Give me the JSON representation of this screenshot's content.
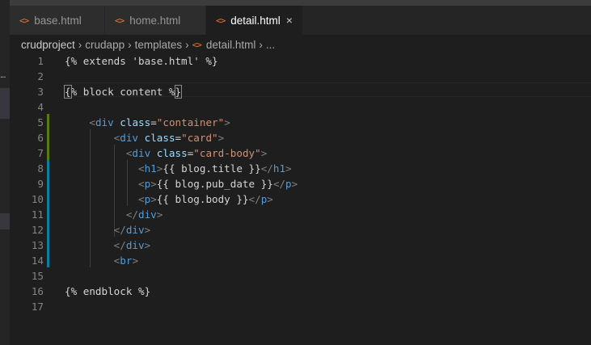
{
  "tabs": [
    {
      "label": "base.html",
      "icon": "html-file-icon",
      "glyph": "<>",
      "active": false
    },
    {
      "label": "home.html",
      "icon": "html-file-icon",
      "glyph": "<>",
      "active": false
    },
    {
      "label": "detail.html",
      "icon": "html-file-icon",
      "glyph": "<>",
      "active": true,
      "close": "×"
    }
  ],
  "breadcrumb": {
    "items": [
      "crudproject",
      "crudapp",
      "templates",
      "detail.html",
      "..."
    ],
    "separator": "›"
  },
  "editor": {
    "lines": [
      {
        "n": "1",
        "text": "{% extends 'base.html' %}"
      },
      {
        "n": "2",
        "text": ""
      },
      {
        "n": "3",
        "text": "{% block content %}"
      },
      {
        "n": "4",
        "text": ""
      },
      {
        "n": "5",
        "text": "    <div class=\"container\">"
      },
      {
        "n": "6",
        "text": "        <div class=\"card\">"
      },
      {
        "n": "7",
        "text": "          <div class=\"card-body\">"
      },
      {
        "n": "8",
        "text": "            <h1>{{ blog.title }}</h1>"
      },
      {
        "n": "9",
        "text": "            <p>{{ blog.pub_date }}</p>"
      },
      {
        "n": "10",
        "text": "            <p>{{ blog.body }}</p>"
      },
      {
        "n": "11",
        "text": "          </div>"
      },
      {
        "n": "12",
        "text": "        </div>"
      },
      {
        "n": "13",
        "text": "        </div>"
      },
      {
        "n": "14",
        "text": "        <br>"
      },
      {
        "n": "15",
        "text": ""
      },
      {
        "n": "16",
        "text": "{% endblock %}"
      },
      {
        "n": "17",
        "text": ""
      }
    ],
    "cursor_line": 3,
    "colors": {
      "tag": "#569cd6",
      "bracket": "#808080",
      "attr": "#9cdcfe",
      "string": "#ce9178",
      "text": "#d4d4d4",
      "added_gutter": "#587c0c",
      "modified_gutter": "#0c7d9d"
    }
  }
}
